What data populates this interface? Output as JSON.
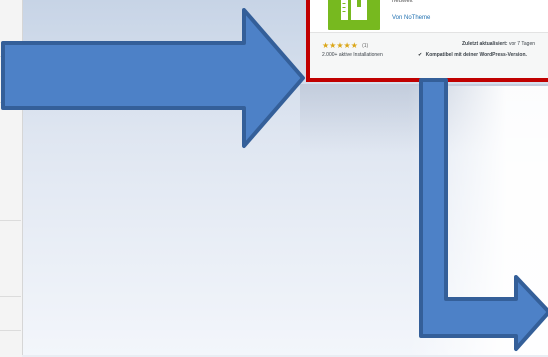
{
  "plugin_card": {
    "description": "neuwelt",
    "author_link": "Von NoTheme",
    "rating": {
      "stars": "★★★★★",
      "count": "(1)"
    },
    "installs": "2.000+ aktive Installationen",
    "updated_label": "Zuletzt aktualisiert:",
    "updated_value": "vor 7 Tagen",
    "compat_text": "Kompatibel mit deiner WordPress-Version."
  },
  "colors": {
    "arrow_fill": "#4d81c7",
    "arrow_stroke": "#345f99",
    "highlight_border": "#c00000",
    "plugin_icon_green": "#77b91f"
  },
  "icons": {
    "plugin_icon": "wrench-ruler-icon",
    "check_icon": "checkmark-icon"
  }
}
